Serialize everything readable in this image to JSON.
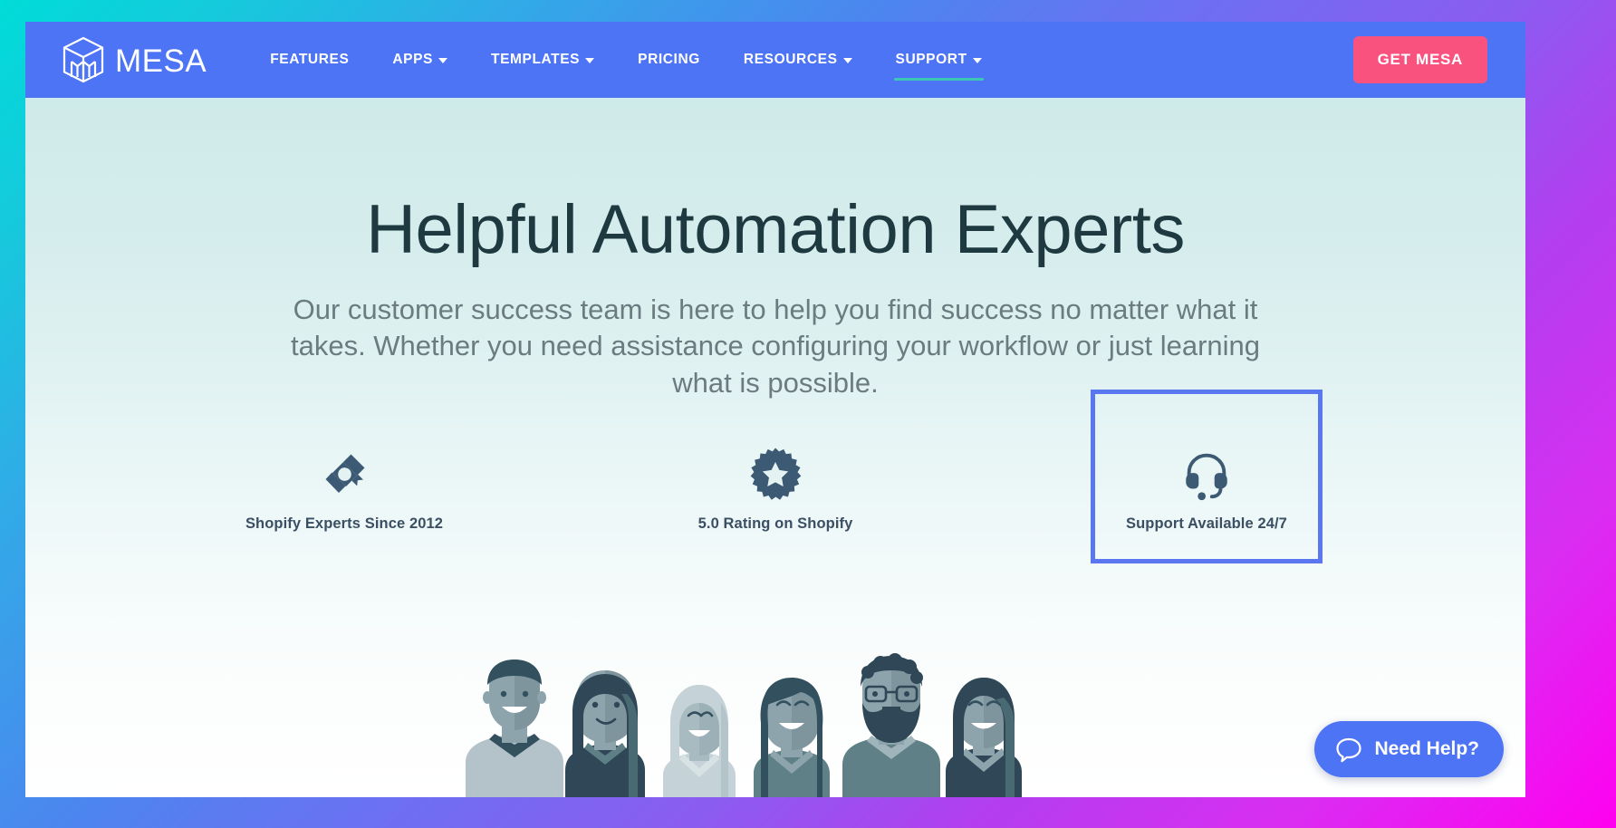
{
  "nav": {
    "brand": {
      "word": "MESA",
      "logo_icon": "mesa-cube-logo-icon"
    },
    "items": [
      {
        "label": "FEATURES",
        "has_dropdown": false,
        "active": false
      },
      {
        "label": "APPS",
        "has_dropdown": true,
        "active": false
      },
      {
        "label": "TEMPLATES",
        "has_dropdown": true,
        "active": false
      },
      {
        "label": "PRICING",
        "has_dropdown": false,
        "active": false
      },
      {
        "label": "RESOURCES",
        "has_dropdown": true,
        "active": false
      },
      {
        "label": "SUPPORT",
        "has_dropdown": true,
        "active": true
      }
    ],
    "cta_label": "GET MESA",
    "colors": {
      "navbar_bg": "#4c74f5",
      "cta_bg": "#f9527e",
      "active_underline": "#3cc8b4"
    }
  },
  "hero": {
    "title": "Helpful Automation Experts",
    "subtitle": "Our customer success team is here to help you find success no matter what it takes. Whether you need assistance configuring your workflow or just learning what is possible.",
    "title_color": "#1e3a40",
    "subtitle_color": "#6b7b80",
    "features": [
      {
        "label": "Shopify Experts Since 2012",
        "icon": "diploma-scroll-icon",
        "highlighted": false
      },
      {
        "label": "5.0 Rating on Shopify",
        "icon": "star-badge-icon",
        "highlighted": false
      },
      {
        "label": "Support Available 24/7",
        "icon": "headset-icon",
        "highlighted": true
      }
    ],
    "illustration": "smiling-team-people-illustration",
    "selection_color": "#5a77f0"
  },
  "widget": {
    "label": "Need Help?",
    "icon": "chat-bubble-icon",
    "bg_color": "#4c74f5"
  },
  "frame": {
    "gradient_start": "#00dcd8",
    "gradient_end": "#ff00f0"
  }
}
